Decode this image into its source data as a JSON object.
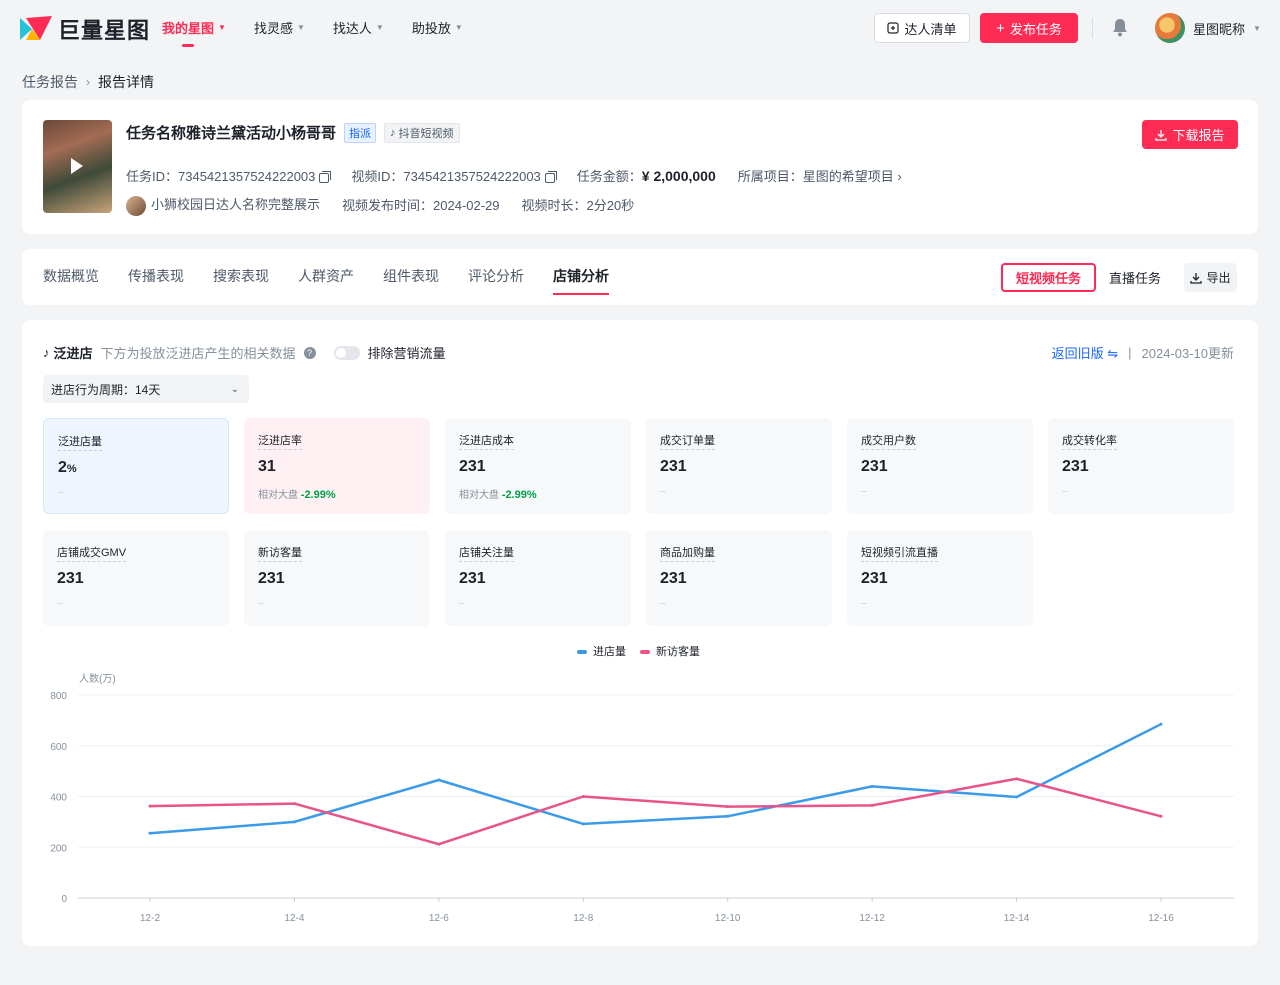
{
  "header": {
    "logo_text": "巨量星图",
    "nav": [
      {
        "label": "我的星图",
        "active": true
      },
      {
        "label": "找灵感",
        "active": false
      },
      {
        "label": "找达人",
        "active": false
      },
      {
        "label": "助投放",
        "active": false
      }
    ],
    "creator_list_label": "达人清单",
    "publish_label": "发布任务",
    "username": "星图昵称"
  },
  "breadcrumb": {
    "parent": "任务报告",
    "current": "报告详情"
  },
  "task": {
    "title": "任务名称雅诗兰黛活动小杨哥哥",
    "tag_assign": "指派",
    "tag_platform": "抖音短视频",
    "task_id_label": "任务ID：",
    "task_id": "7345421357524222003",
    "video_id_label": "视频ID：",
    "video_id": "7345421357524222003",
    "amount_label": "任务金额：",
    "amount": "¥ 2,000,000",
    "project_label": "所属项目：",
    "project": "星图的希望项目",
    "creator_name": "小狮校园日达人名称完整展示",
    "publish_time_label": "视频发布时间：",
    "publish_time": "2024-02-29",
    "duration_label": "视频时长：",
    "duration": "2分20秒",
    "download_label": "下载报告"
  },
  "tabs": {
    "items": [
      "数据概览",
      "传播表现",
      "搜索表现",
      "人群资产",
      "组件表现",
      "评论分析",
      "店铺分析"
    ],
    "active_index": 6,
    "segment": [
      "短视频任务",
      "直播任务"
    ],
    "export_label": "导出"
  },
  "section": {
    "title": "泛进店",
    "desc": "下方为投放泛进店产生的相关数据",
    "toggle_label": "排除营销流量",
    "back_old": "返回旧版",
    "updated": "2024-03-10更新",
    "period_select": "进店行为周期：14天"
  },
  "metrics": [
    {
      "label": "泛进店量",
      "value": "2",
      "unit": "%",
      "sub_label": "",
      "sub_value": "",
      "empty": "–",
      "style": "blue"
    },
    {
      "label": "泛进店率",
      "value": "31",
      "unit": "",
      "sub_label": "相对大盘",
      "sub_value": "-2.99%",
      "empty": "",
      "style": "pink"
    },
    {
      "label": "泛进店成本",
      "value": "231",
      "unit": "",
      "sub_label": "相对大盘",
      "sub_value": "-2.99%",
      "empty": "",
      "style": "gray"
    },
    {
      "label": "成交订单量",
      "value": "231",
      "unit": "",
      "sub_label": "",
      "sub_value": "",
      "empty": "–",
      "style": "gray"
    },
    {
      "label": "成交用户数",
      "value": "231",
      "unit": "",
      "sub_label": "",
      "sub_value": "",
      "empty": "–",
      "style": "gray"
    },
    {
      "label": "成交转化率",
      "value": "231",
      "unit": "",
      "sub_label": "",
      "sub_value": "",
      "empty": "–",
      "style": "gray"
    },
    {
      "label": "店铺成交GMV",
      "value": "231",
      "unit": "",
      "sub_label": "",
      "sub_value": "",
      "empty": "–",
      "style": "gray"
    },
    {
      "label": "新访客量",
      "value": "231",
      "unit": "",
      "sub_label": "",
      "sub_value": "",
      "empty": "–",
      "style": "gray"
    },
    {
      "label": "店铺关注量",
      "value": "231",
      "unit": "",
      "sub_label": "",
      "sub_value": "",
      "empty": "–",
      "style": "gray"
    },
    {
      "label": "商品加购量",
      "value": "231",
      "unit": "",
      "sub_label": "",
      "sub_value": "",
      "empty": "–",
      "style": "gray"
    },
    {
      "label": "短视频引流直播",
      "value": "231",
      "unit": "",
      "sub_label": "",
      "sub_value": "",
      "empty": "–",
      "style": "gray"
    }
  ],
  "colors": {
    "brand": "#fe2c55",
    "series1": "#3b9be8",
    "series2": "#e8548a"
  },
  "chart_data": {
    "type": "line",
    "title": "",
    "ylabel": "人数(万)",
    "xlabel": "",
    "x": [
      "12-2",
      "12-4",
      "12-6",
      "12-8",
      "12-10",
      "12-12",
      "12-14",
      "12-16"
    ],
    "ylim": [
      0,
      800
    ],
    "yticks": [
      0,
      200,
      400,
      600,
      800
    ],
    "grid": true,
    "legend_position": "top-center",
    "series": [
      {
        "name": "进店量",
        "values": [
          255,
          300,
          465,
          292,
          322,
          440,
          398,
          685
        ]
      },
      {
        "name": "新访客量",
        "values": [
          362,
          372,
          212,
          400,
          360,
          365,
          470,
          322
        ]
      }
    ]
  }
}
